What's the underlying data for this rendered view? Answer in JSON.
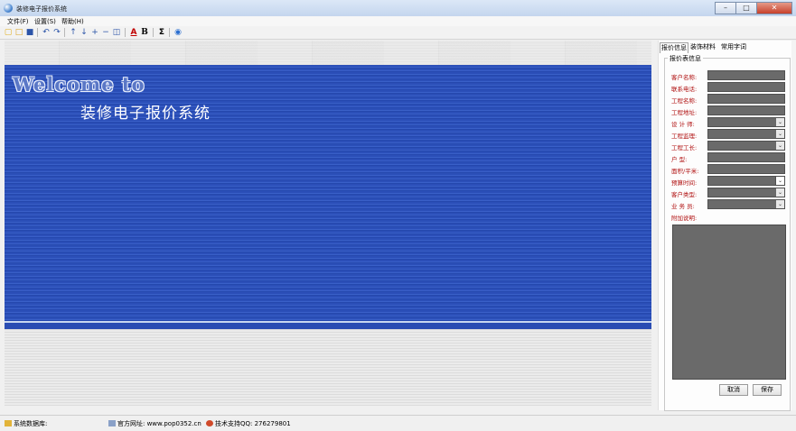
{
  "window": {
    "title": "装修电子报价系统"
  },
  "menu": [
    "文件(F)",
    "设置(S)",
    "帮助(H)"
  ],
  "toolbar": {
    "icons": [
      "new-icon",
      "open-icon",
      "save-icon",
      "undo-icon",
      "redo-icon",
      "move-up-icon",
      "move-down-icon",
      "insert-icon",
      "delete-icon",
      "window-icon",
      "text-color-icon",
      "bold-icon",
      "sum-icon",
      "help-icon"
    ]
  },
  "banner": {
    "welcome": "Welcome to",
    "subtitle": "装修电子报价系统"
  },
  "side": {
    "tabs": [
      "报价信息",
      "装饰材料",
      "常用字词"
    ],
    "group_title": "报价表信息",
    "fields": [
      {
        "label": "客户名称:",
        "kind": "text"
      },
      {
        "label": "联系电话:",
        "kind": "text"
      },
      {
        "label": "工程名称:",
        "kind": "text"
      },
      {
        "label": "工程地址:",
        "kind": "text"
      },
      {
        "label": "设 计 师:",
        "kind": "combo"
      },
      {
        "label": "工程监理:",
        "kind": "combo"
      },
      {
        "label": "工程工长:",
        "kind": "combo"
      },
      {
        "label": "户    型:",
        "kind": "text"
      },
      {
        "label": "面积/平米:",
        "kind": "text"
      },
      {
        "label": "预算时间:",
        "kind": "combo"
      },
      {
        "label": "客户类型:",
        "kind": "combo"
      },
      {
        "label": "业 务 员:",
        "kind": "combo"
      }
    ],
    "notes_label": "附加说明:",
    "cancel_label": "取消",
    "save_label": "保存"
  },
  "status": {
    "db": "系统数据库:",
    "website": "官方网址: www.pop0352.cn",
    "support": "技术支持QQ: 276279801"
  },
  "colors": {
    "accent_blue": "#2b4fb8",
    "label_red": "#b01010"
  }
}
